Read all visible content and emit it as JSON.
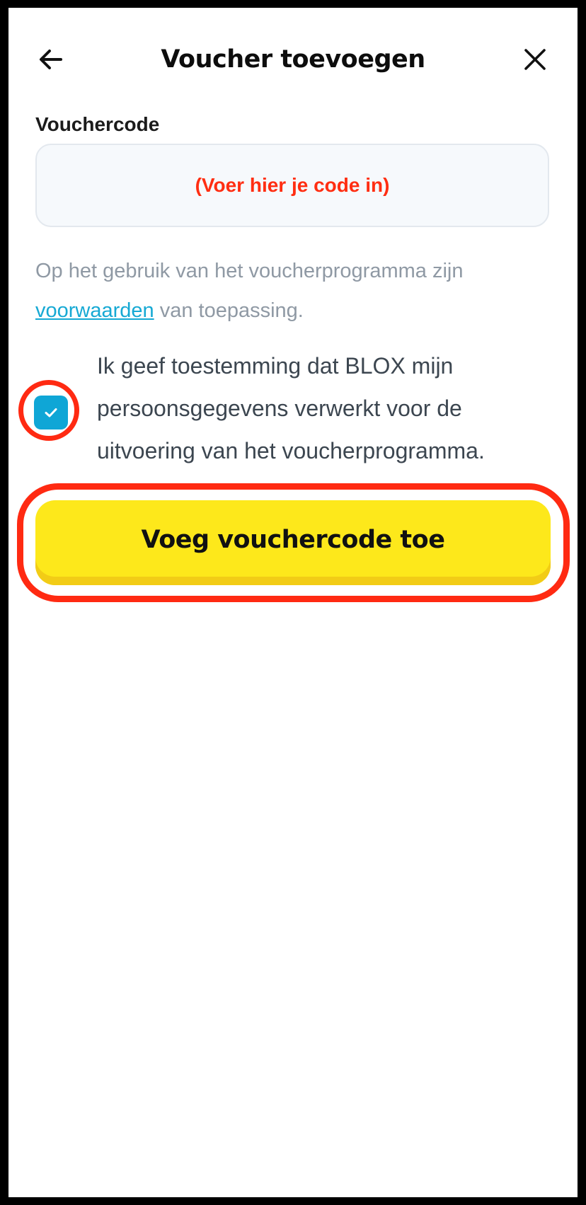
{
  "header": {
    "title": "Voucher toevoegen",
    "back_icon": "arrow-left-icon",
    "close_icon": "close-icon"
  },
  "voucher": {
    "label": "Vouchercode",
    "placeholder": "(Voer hier je code in)"
  },
  "terms": {
    "text_before": "Op het gebruik van het voucherprogramma zijn ",
    "link": "voorwaarden",
    "text_after": " van toepassing."
  },
  "consent": {
    "checked": true,
    "text": "Ik geef toestemming dat BLOX mijn persoonsgegevens verwerkt voor de uitvoering van het voucherprogramma."
  },
  "submit": {
    "label": "Voeg vouchercode toe"
  },
  "colors": {
    "accent": "#0fa6d6",
    "button": "#fde81b",
    "highlight": "#ff2a12",
    "link": "#16a9d4"
  }
}
